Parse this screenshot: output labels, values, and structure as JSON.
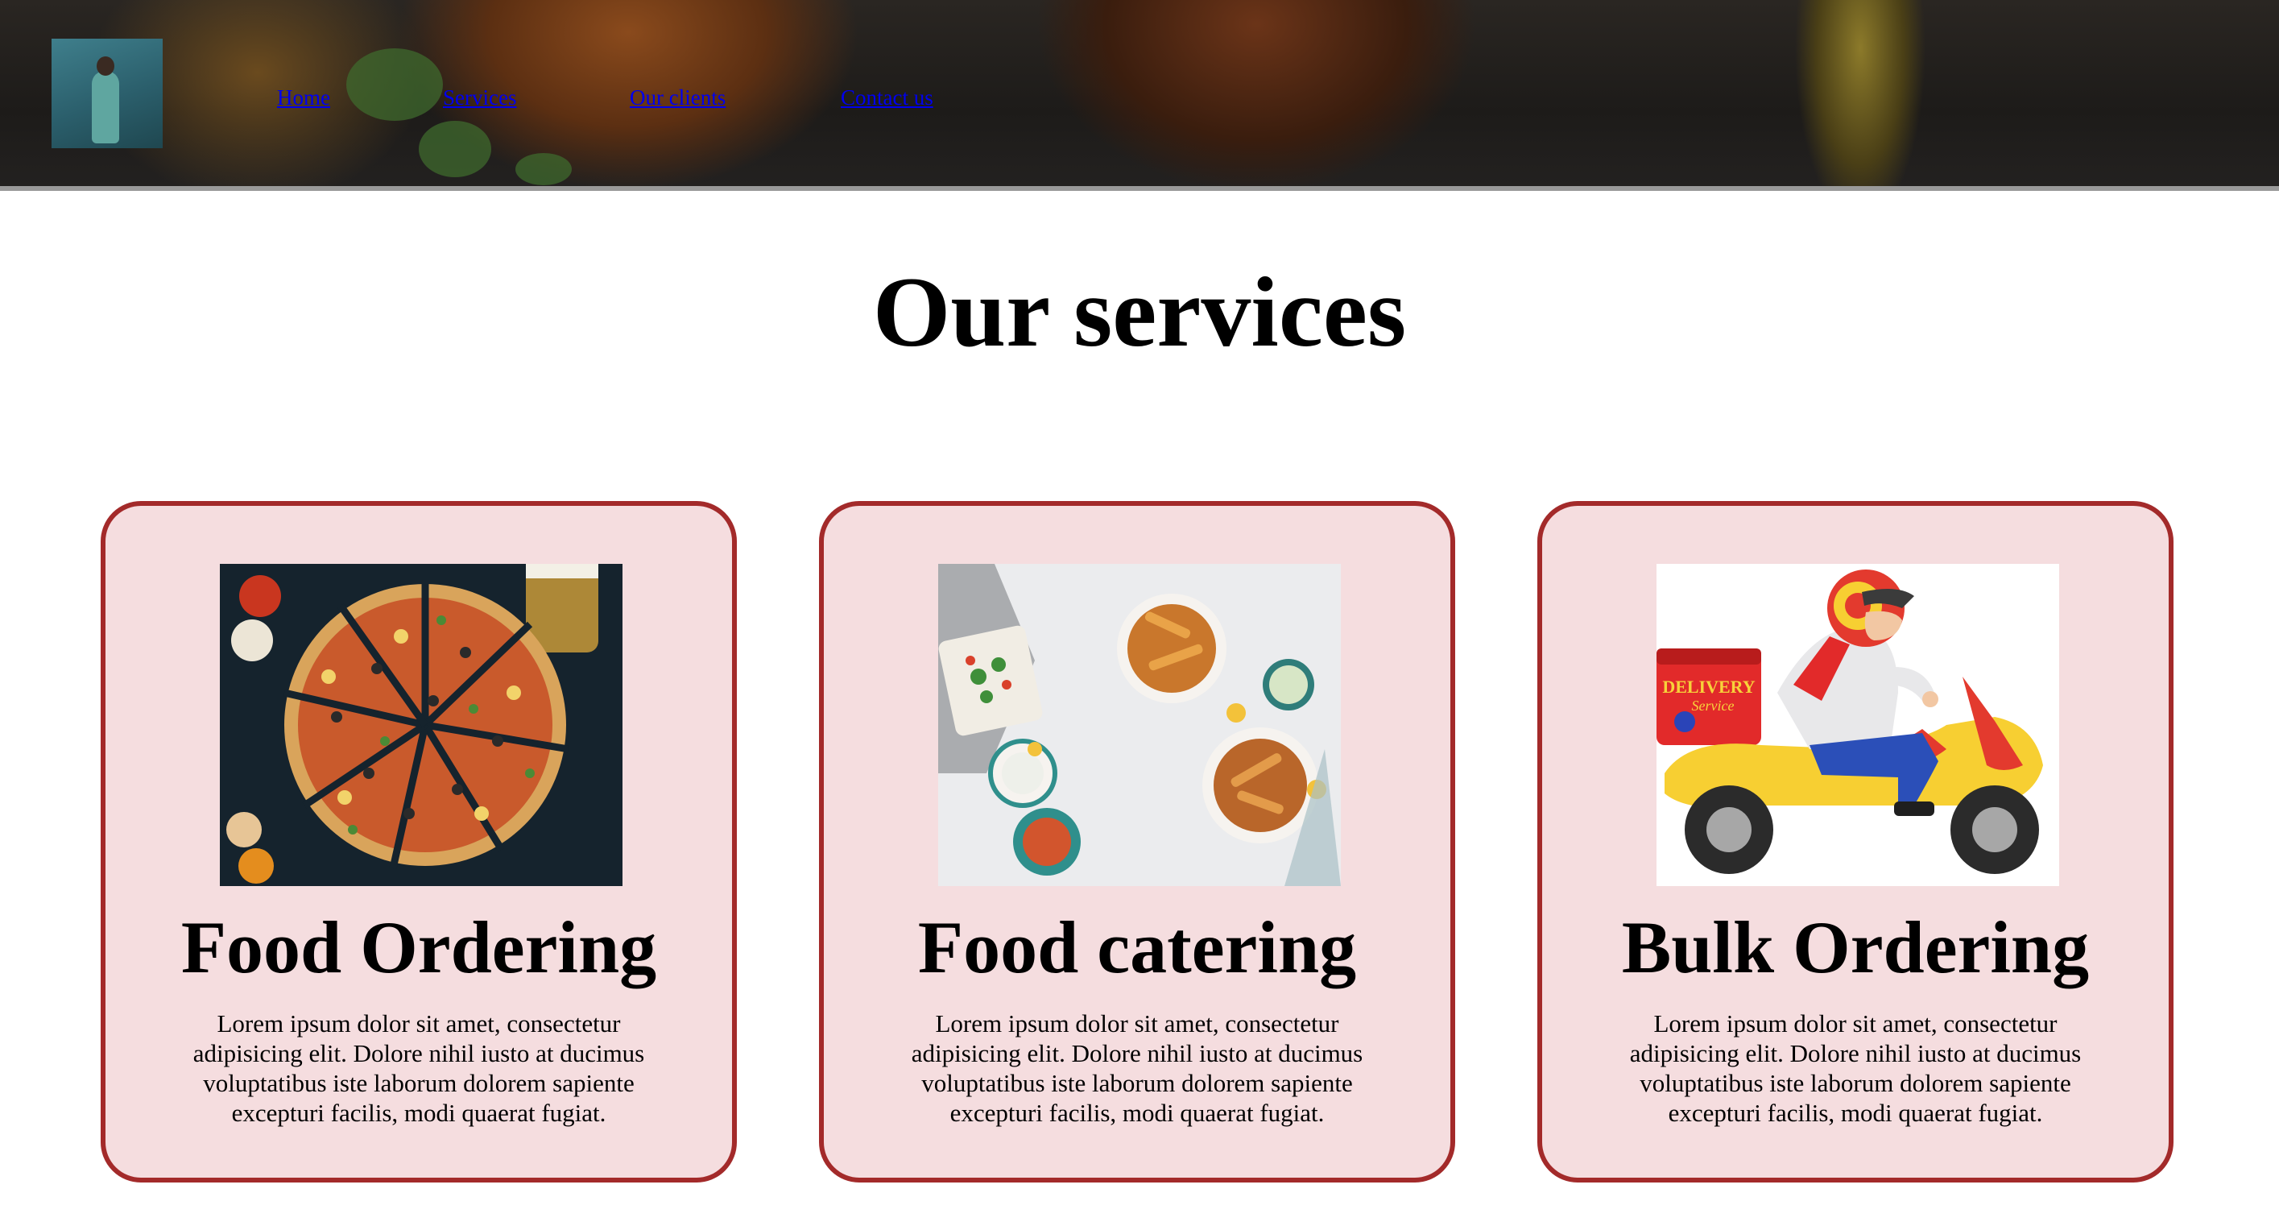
{
  "header": {
    "logo_alt": "logo",
    "nav": [
      {
        "label": "Home"
      },
      {
        "label": "Services"
      },
      {
        "label": "Our clients"
      },
      {
        "label": "Contact us"
      }
    ]
  },
  "main": {
    "title": "Our services",
    "cards": [
      {
        "title": "Food Ordering",
        "text": "Lorem ipsum dolor sit amet, consectetur adipisicing elit. Dolore nihil iusto at ducimus voluptatibus iste laborum dolorem sapiente excepturi facilis, modi quaerat fugiat.",
        "image": "pizza-photo"
      },
      {
        "title": "Food catering",
        "text": "Lorem ipsum dolor sit amet, consectetur adipisicing elit. Dolore nihil iusto at ducimus voluptatibus iste laborum dolorem sapiente excepturi facilis, modi quaerat fugiat.",
        "image": "catering-photo"
      },
      {
        "title": "Bulk Ordering",
        "text": "Lorem ipsum dolor sit amet, consectetur adipisicing elit. Dolore nihil iusto at ducimus voluptatibus iste laborum dolorem sapiente excepturi facilis, modi quaerat fugiat.",
        "image": "delivery-scooter-illustration",
        "image_text": [
          "DELIVERY",
          "Service"
        ]
      }
    ]
  },
  "colors": {
    "card_bg": "#f5dddf",
    "card_border": "#a32a2a",
    "link": "#0000ee"
  }
}
